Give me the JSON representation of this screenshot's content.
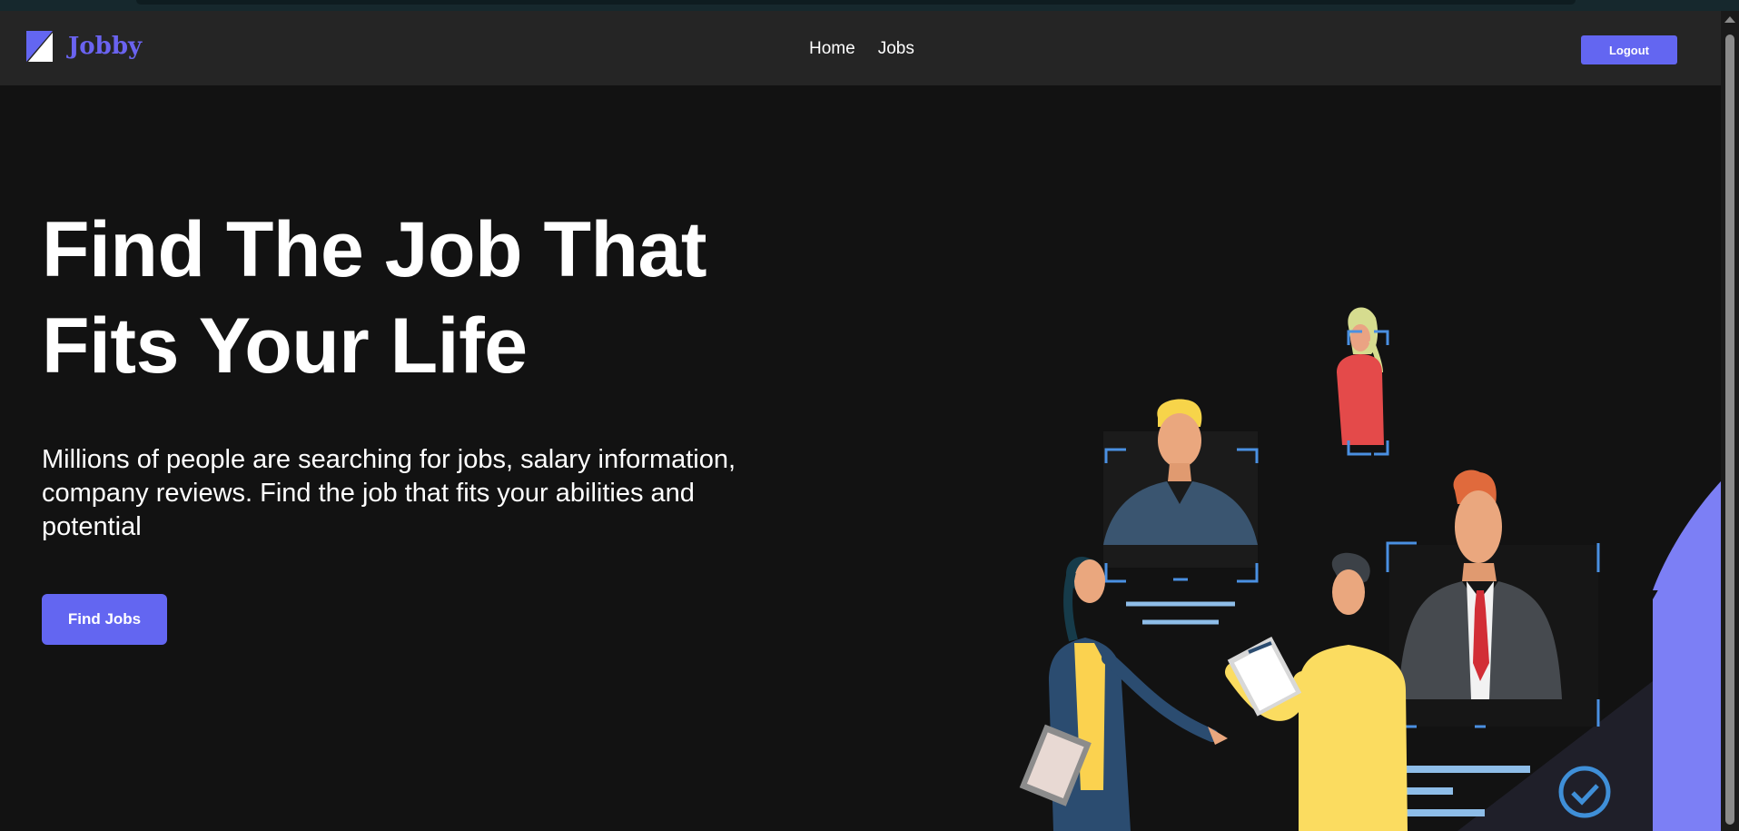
{
  "navbar": {
    "brand": "Jobby",
    "links": [
      "Home",
      "Jobs"
    ],
    "logout_label": "Logout"
  },
  "hero": {
    "title_line1": "Find The Job That",
    "title_line2": "Fits Your Life",
    "description": "Millions of people are searching for jobs, salary information, company reviews. Find the job that fits your abilities and potential",
    "cta_label": "Find Jobs"
  },
  "colors": {
    "accent": "#6366f1",
    "brand": "#6a63f0",
    "background": "#121212",
    "navbar": "#252525"
  },
  "icons": [
    "jobby-logo-icon",
    "hiring-illustration",
    "checkmark-circle-icon"
  ]
}
